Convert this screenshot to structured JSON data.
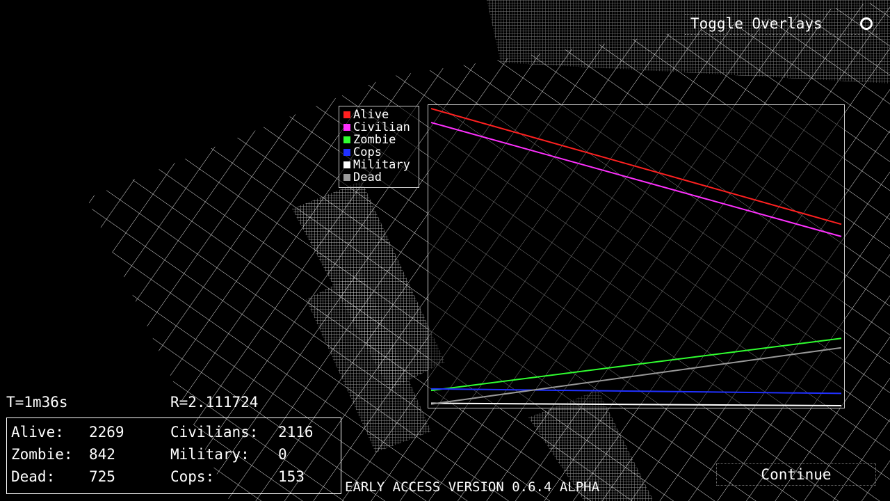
{
  "hud": {
    "time": "T=1m36s",
    "r_value": "R=2.111724",
    "stats": [
      {
        "label": "Alive:",
        "value": "2269"
      },
      {
        "label": "Zombie:",
        "value": "842"
      },
      {
        "label": "Dead:",
        "value": "725"
      },
      {
        "label": "Civilians:",
        "value": "2116"
      },
      {
        "label": "Military:",
        "value": "0"
      },
      {
        "label": "Cops:",
        "value": "153"
      }
    ]
  },
  "toggle_overlays_label": "Toggle Overlays",
  "continue_label": "Continue",
  "version_text": "EARLY ACCESS VERSION 0.6.4 ALPHA",
  "chart_data": {
    "type": "line",
    "title": "",
    "ylim": [
      0,
      3760
    ],
    "x": [
      0,
      1
    ],
    "legend": "top-left",
    "series": [
      {
        "name": "Alive",
        "color": "#ff2020",
        "values": [
          3716,
          2269
        ]
      },
      {
        "name": "Civilian",
        "color": "#ff30ff",
        "values": [
          3542,
          2116
        ]
      },
      {
        "name": "Zombie",
        "color": "#30ff30",
        "values": [
          190,
          842
        ]
      },
      {
        "name": "Cops",
        "color": "#2030ff",
        "values": [
          210,
          153
        ]
      },
      {
        "name": "Military",
        "color": "#ffffff",
        "values": [
          30,
          0
        ]
      },
      {
        "name": "Dead",
        "color": "#999999",
        "values": [
          20,
          725
        ]
      }
    ]
  }
}
